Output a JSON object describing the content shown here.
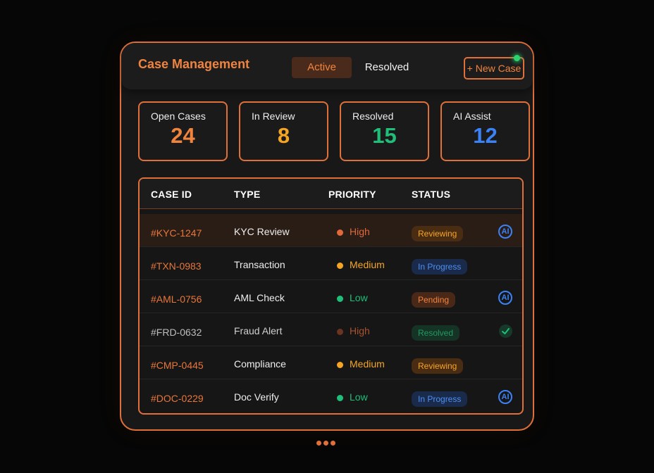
{
  "header": {
    "title": "Case Management",
    "tabs": [
      {
        "label": "Active",
        "active": true
      },
      {
        "label": "Resolved",
        "active": false
      }
    ],
    "new_case_label": "+ New Case"
  },
  "stats": [
    {
      "label": "Open Cases",
      "value": "24",
      "color": "#f0843f"
    },
    {
      "label": "In Review",
      "value": "8",
      "color": "#f5a524"
    },
    {
      "label": "Resolved",
      "value": "15",
      "color": "#1fbf7a"
    },
    {
      "label": "AI Assist",
      "value": "12",
      "color": "#3b82f6"
    }
  ],
  "table": {
    "columns": [
      "CASE ID",
      "TYPE",
      "PRIORITY",
      "STATUS"
    ],
    "rows": [
      {
        "id": "#KYC-1247",
        "type": "KYC Review",
        "priority": "High",
        "status": "Reviewing",
        "icon": "ai-icon",
        "ai": "AI"
      },
      {
        "id": "#TXN-0983",
        "type": "Transaction",
        "priority": "Medium",
        "status": "In Progress",
        "icon": ""
      },
      {
        "id": "#AML-0756",
        "type": "AML Check",
        "priority": "Low",
        "status": "Pending",
        "icon": "ai-icon",
        "ai": "AI"
      },
      {
        "id": "#FRD-0632",
        "type": "Fraud Alert",
        "priority": "High",
        "status": "Resolved",
        "icon": "check-icon"
      },
      {
        "id": "#CMP-0445",
        "type": "Compliance",
        "priority": "Medium",
        "status": "Reviewing",
        "icon": ""
      },
      {
        "id": "#DOC-0229",
        "type": "Doc Verify",
        "priority": "Low",
        "status": "In Progress",
        "icon": "ai-icon",
        "ai": "AI"
      }
    ]
  },
  "colors": {
    "accent": "#e0703a",
    "high": "#e0683a",
    "medium": "#f5a524",
    "low": "#1fbf7a",
    "ai": "#3b82f6"
  }
}
